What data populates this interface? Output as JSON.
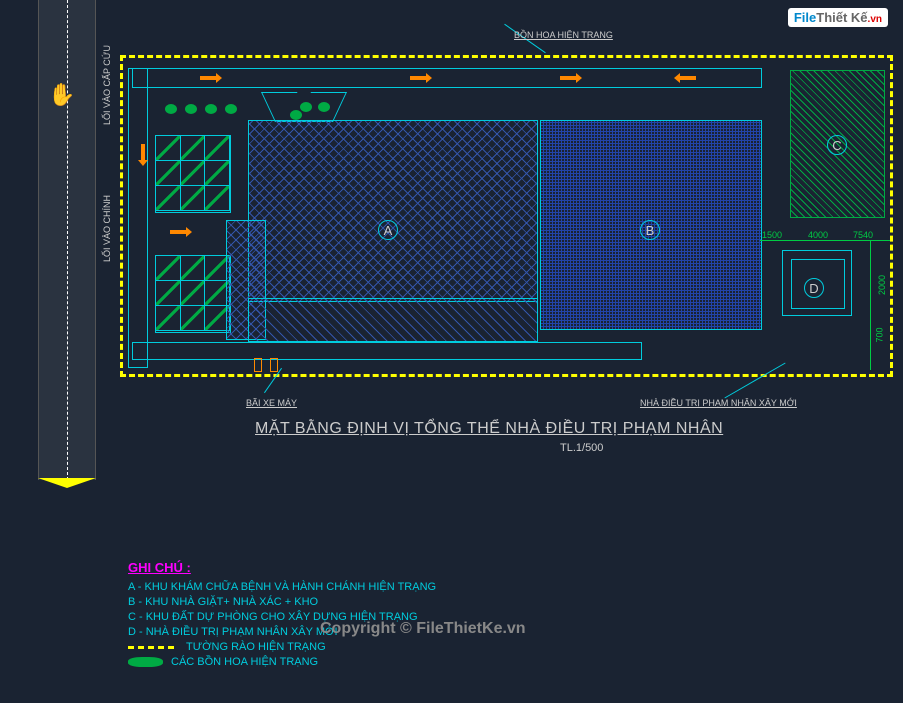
{
  "logo": {
    "file": "File",
    "thiet": "Thiết Kế",
    "vn": ".vn"
  },
  "copyright": "Copyright © FileThietKe.vn",
  "road": {
    "label_emergency": "LỐI VÀO CẤP CỨU",
    "label_main": "LỐI VÀO CHÍNH"
  },
  "leaders": {
    "flower": "BỒN HOA HIỆN TRẠNG",
    "bike": "BÃI XE MÁY",
    "new_bldg": "NHÀ ĐIỀU TRỊ PHẠM NHÂN XÂY MỚI"
  },
  "zones": {
    "a": "A",
    "b": "B",
    "c": "C",
    "d": "D"
  },
  "dims": {
    "d1": "1500",
    "d2": "4000",
    "d3": "7540",
    "d4": "2000",
    "d5": "700"
  },
  "title": "MẶT BẰNG ĐỊNH VỊ TỔNG THỂ NHÀ ĐIỀU TRỊ PHẠM NHÂN",
  "scale": "TL.1/500",
  "legend": {
    "title": "GHI CHÚ :",
    "a": "A - KHU KHÁM CHỮA BỆNH VÀ HÀNH CHÁNH HIỆN TRẠNG",
    "b": "B - KHU NHÀ GIẶT+ NHÀ XÁC + KHO",
    "c": "C - KHU ĐẤT DỰ PHÒNG CHO XÂY DỰNG HIỆN TRẠNG",
    "d": "D - NHÀ ĐIỀU TRỊ PHẠM NHÂN XÂY MỚI",
    "fence": "TƯỜNG RÀO HIỆN TRẠNG",
    "bush": "CÁC BỒN HOA HIỆN TRẠNG"
  }
}
